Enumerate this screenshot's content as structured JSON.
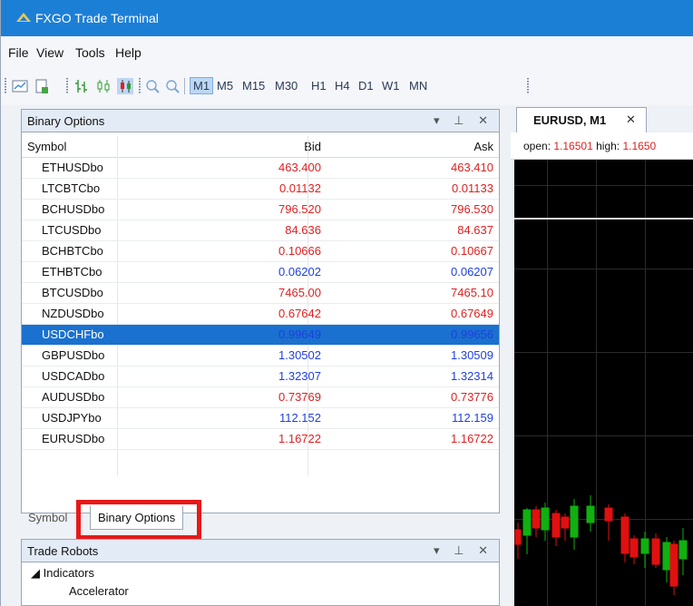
{
  "app": {
    "title": "FXGO Trade Terminal"
  },
  "menu": [
    "File",
    "View",
    "Tools",
    "Help"
  ],
  "toolbar": {
    "timeframes": [
      "M1",
      "M5",
      "M15",
      "M30",
      "H1",
      "H4",
      "D1",
      "W1",
      "MN"
    ],
    "active_timeframe": "M1"
  },
  "binary_panel": {
    "title": "Binary Options",
    "controls": "▾ ⊥ ✕",
    "columns": [
      "Symbol",
      "Bid",
      "Ask"
    ],
    "rows": [
      {
        "symbol": "ETHUSDbo",
        "bid": "463.400",
        "ask": "463.410",
        "color": "#e02020"
      },
      {
        "symbol": "LTCBTCbo",
        "bid": "0.01132",
        "ask": "0.01133",
        "color": "#e02020"
      },
      {
        "symbol": "BCHUSDbo",
        "bid": "796.520",
        "ask": "796.530",
        "color": "#e02020"
      },
      {
        "symbol": "LTCUSDbo",
        "bid": "84.636",
        "ask": "84.637",
        "color": "#e02020"
      },
      {
        "symbol": "BCHBTCbo",
        "bid": "0.10666",
        "ask": "0.10667",
        "color": "#e02020"
      },
      {
        "symbol": "ETHBTCbo",
        "bid": "0.06202",
        "ask": "0.06207",
        "color": "#1f3fe0"
      },
      {
        "symbol": "BTCUSDbo",
        "bid": "7465.00",
        "ask": "7465.10",
        "color": "#e02020"
      },
      {
        "symbol": "NZDUSDbo",
        "bid": "0.67642",
        "ask": "0.67649",
        "color": "#e02020"
      },
      {
        "symbol": "USDCHFbo",
        "bid": "0.99649",
        "ask": "0.99656",
        "color": "#1f3fe0",
        "selected": true
      },
      {
        "symbol": "GBPUSDbo",
        "bid": "1.30502",
        "ask": "1.30509",
        "color": "#1f3fe0"
      },
      {
        "symbol": "USDCADbo",
        "bid": "1.32307",
        "ask": "1.32314",
        "color": "#1f3fe0"
      },
      {
        "symbol": "AUDUSDbo",
        "bid": "0.73769",
        "ask": "0.73776",
        "color": "#e02020"
      },
      {
        "symbol": "USDJPYbo",
        "bid": "112.152",
        "ask": "112.159",
        "color": "#1f3fe0"
      },
      {
        "symbol": "EURUSDbo",
        "bid": "1.16722",
        "ask": "1.16722",
        "color": "#e02020"
      }
    ]
  },
  "tabs": {
    "symbols": "Symbol",
    "binary": "Binary Options"
  },
  "robots_panel": {
    "title": "Trade Robots",
    "controls": "▾ ⊥ ✕",
    "tree_root": "◢ Indicators",
    "tree_child": "Accelerator"
  },
  "chart": {
    "tab_label": "EURUSD, M1",
    "tab_close": "✕",
    "open_label": "open:",
    "open_value": "1.16501",
    "high_label": "high:",
    "high_value": "1.1650"
  },
  "colors": {
    "up": "#10b010",
    "down": "#e01010",
    "title_bar": "#1c7fd6"
  }
}
